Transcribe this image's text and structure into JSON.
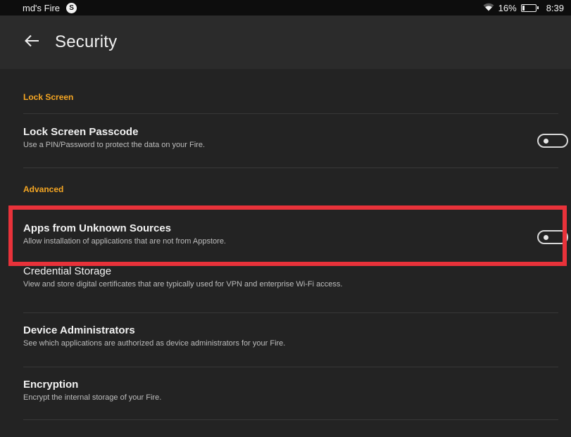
{
  "status_bar": {
    "device_name": "md's Fire",
    "notification_badge": "S",
    "battery_percent": "16%",
    "battery_level": 0.16,
    "time": "8:39"
  },
  "title_bar": {
    "title": "Security"
  },
  "sections": [
    {
      "header": "Lock Screen",
      "items": [
        {
          "title": "Lock Screen Passcode",
          "description": "Use a PIN/Password to protect the data on your Fire.",
          "toggle_on": false
        }
      ]
    },
    {
      "header": "Advanced",
      "items": [
        {
          "title": "Apps from Unknown Sources",
          "description": "Allow installation of applications that are not from Appstore.",
          "toggle_on": false
        },
        {
          "title": "Credential Storage",
          "description": "View and store digital certificates that are typically used for VPN and enterprise Wi-Fi access."
        },
        {
          "title": "Device Administrators",
          "description": "See which applications are authorized as device administrators for your Fire."
        },
        {
          "title": "Encryption",
          "description": "Encrypt the internal storage of your Fire."
        }
      ]
    }
  ],
  "colors": {
    "accent_section_header": "#f5a623",
    "highlight_box": "#e8323a",
    "background": "#232323"
  },
  "icons": {
    "back": "arrow-left-icon",
    "wifi": "wifi-icon",
    "battery": "battery-icon"
  }
}
